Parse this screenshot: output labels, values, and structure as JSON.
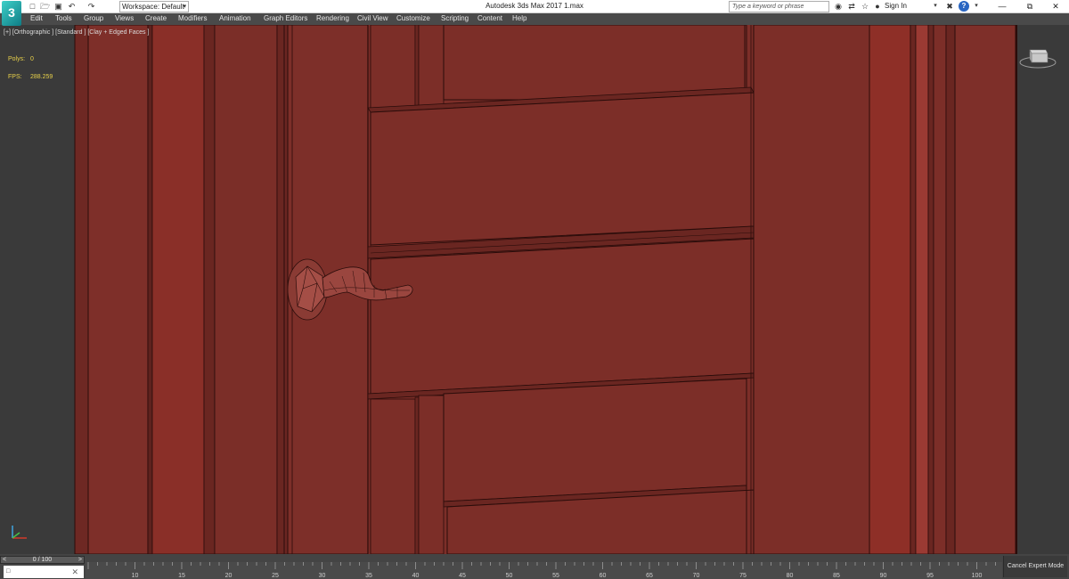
{
  "titlebar": {
    "logo_text": "3",
    "workspace_label": "Workspace: Default",
    "window_title": "Autodesk 3ds Max 2017     1.max",
    "search_placeholder": "Type a keyword or phrase",
    "sign_in": "Sign In",
    "help": "?",
    "icons": [
      "new-file-icon",
      "open-folder-icon",
      "save-icon",
      "undo-icon",
      "redo-icon",
      "binoculars-icon",
      "exchange-icon",
      "star-icon",
      "user-icon",
      "close-x-icon",
      "help-icon"
    ]
  },
  "menu": {
    "items": [
      "Edit",
      "Tools",
      "Group",
      "Views",
      "Create",
      "Modifiers",
      "Animation",
      "Graph Editors",
      "Rendering",
      "Civil View",
      "Customize",
      "Scripting",
      "Content",
      "Help"
    ]
  },
  "viewport": {
    "label": "[+] [Orthographic ] [Standard ] [Clay + Edged Faces ]",
    "polys_label": "Polys:",
    "polys_value": "0",
    "fps_label": "FPS:",
    "fps_value": "288.259",
    "background_color": "#3a3a3a",
    "material_color": "#7c2e28"
  },
  "timeline": {
    "slider_value": "0 / 100",
    "ticks": [
      "10",
      "15",
      "20",
      "25",
      "30",
      "35",
      "40",
      "45",
      "50",
      "55",
      "60",
      "65",
      "70",
      "75",
      "80",
      "85",
      "90",
      "95",
      "100"
    ],
    "cancel_expert": "Cancel Expert Mode",
    "listener_text": "□"
  }
}
